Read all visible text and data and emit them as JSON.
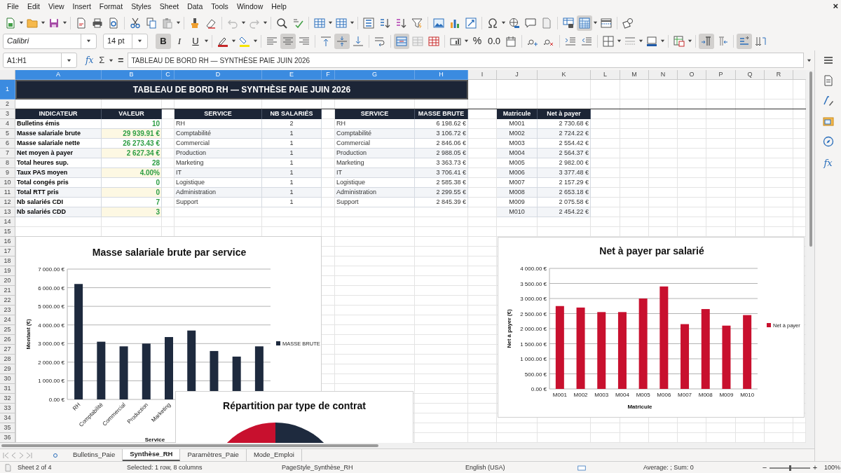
{
  "menu": [
    "File",
    "Edit",
    "View",
    "Insert",
    "Format",
    "Styles",
    "Sheet",
    "Data",
    "Tools",
    "Window",
    "Help"
  ],
  "close_label": "×",
  "standard_toolbar": {
    "freeze_rows_columns": {
      "selected": true
    }
  },
  "formatting_toolbar": {
    "font_name": "Calibri",
    "font_size": "14 pt",
    "bold": {
      "label": "B",
      "selected": true
    },
    "italic": {
      "label": "I",
      "selected": false
    },
    "underline": {
      "label": "U",
      "selected": false
    },
    "align_left": {
      "selected": false
    },
    "align_center": {
      "selected": true
    },
    "align_right": {
      "selected": false
    },
    "align_top": {
      "selected": false
    },
    "align_middle": {
      "selected": true
    },
    "align_bottom": {
      "selected": false
    },
    "merge_and_center": {
      "selected": true
    },
    "percent": {
      "label": "%"
    },
    "decimal": {
      "label": "0.0"
    },
    "left_to_right": {
      "selected": true
    },
    "right_to_left": {
      "selected": false
    },
    "wrap_text": {
      "selected": true
    }
  },
  "formula_bar": {
    "name_box": "A1:H1",
    "function_label": "fx",
    "sum_label": "Σ",
    "equals_label": "=",
    "content": "TABLEAU DE BORD RH — SYNTHÈSE PAIE JUIN 2026"
  },
  "sidebar": {
    "functions_label": "fx"
  },
  "sheet": {
    "columns": [
      {
        "label": "A",
        "selected": true
      },
      {
        "label": "B",
        "selected": true
      },
      {
        "label": "C",
        "selected": true
      },
      {
        "label": "D",
        "selected": true
      },
      {
        "label": "E",
        "selected": true
      },
      {
        "label": "F",
        "selected": true
      },
      {
        "label": "G",
        "selected": true
      },
      {
        "label": "H",
        "selected": true
      },
      {
        "label": "I",
        "selected": false
      },
      {
        "label": "J",
        "selected": false
      },
      {
        "label": "K",
        "selected": false
      },
      {
        "label": "L",
        "selected": false
      },
      {
        "label": "M",
        "selected": false
      },
      {
        "label": "N",
        "selected": false
      },
      {
        "label": "O",
        "selected": false
      },
      {
        "label": "P",
        "selected": false
      },
      {
        "label": "Q",
        "selected": false
      },
      {
        "label": "R",
        "selected": false
      }
    ],
    "rows": [
      {
        "label": "1",
        "selected": true
      },
      {
        "label": "2",
        "selected": false
      },
      {
        "label": "3",
        "selected": false
      },
      {
        "label": "4",
        "selected": false
      },
      {
        "label": "5",
        "selected": false
      },
      {
        "label": "6",
        "selected": false
      },
      {
        "label": "7",
        "selected": false
      },
      {
        "label": "8",
        "selected": false
      },
      {
        "label": "9",
        "selected": false
      },
      {
        "label": "10",
        "selected": false
      },
      {
        "label": "11",
        "selected": false
      },
      {
        "label": "12",
        "selected": false
      },
      {
        "label": "13",
        "selected": false
      },
      {
        "label": "14",
        "selected": false
      },
      {
        "label": "15",
        "selected": false
      },
      {
        "label": "16",
        "selected": false
      },
      {
        "label": "17",
        "selected": false
      },
      {
        "label": "18",
        "selected": false
      },
      {
        "label": "19",
        "selected": false
      },
      {
        "label": "20",
        "selected": false
      },
      {
        "label": "21",
        "selected": false
      },
      {
        "label": "22",
        "selected": false
      },
      {
        "label": "23",
        "selected": false
      },
      {
        "label": "24",
        "selected": false
      },
      {
        "label": "25",
        "selected": false
      },
      {
        "label": "26",
        "selected": false
      },
      {
        "label": "27",
        "selected": false
      },
      {
        "label": "28",
        "selected": false
      },
      {
        "label": "29",
        "selected": false
      },
      {
        "label": "30",
        "selected": false
      },
      {
        "label": "31",
        "selected": false
      },
      {
        "label": "32",
        "selected": false
      },
      {
        "label": "33",
        "selected": false
      },
      {
        "label": "34",
        "selected": false
      },
      {
        "label": "35",
        "selected": false
      },
      {
        "label": "36",
        "selected": false
      }
    ],
    "title": "TABLEAU DE BORD RH — SYNTHÈSE PAIE JUIN 2026",
    "tables": [
      {
        "columns": [
          "INDICATEUR",
          "VALEUR"
        ],
        "rows": [
          [
            "Bulletins émis",
            "10"
          ],
          [
            "Masse salariale brute",
            "29 939.91 €"
          ],
          [
            "Masse salariale nette",
            "26 273.43 €"
          ],
          [
            "Net moyen à payer",
            "2 627.34 €"
          ],
          [
            "Total heures sup.",
            "28"
          ],
          [
            "Taux PAS moyen",
            "4.00%"
          ],
          [
            "Total congés pris",
            "0"
          ],
          [
            "Total RTT pris",
            "0"
          ],
          [
            "Nb salariés CDI",
            "7"
          ],
          [
            "Nb salariés CDD",
            "3"
          ]
        ]
      },
      {
        "columns": [
          "SERVICE",
          "NB SALARIÉS"
        ],
        "rows": [
          [
            "RH",
            "2"
          ],
          [
            "Comptabilité",
            "1"
          ],
          [
            "Commercial",
            "1"
          ],
          [
            "Production",
            "1"
          ],
          [
            "Marketing",
            "1"
          ],
          [
            "IT",
            "1"
          ],
          [
            "Logistique",
            "1"
          ],
          [
            "Administration",
            "1"
          ],
          [
            "Support",
            "1"
          ]
        ]
      },
      {
        "columns": [
          "SERVICE",
          "MASSE BRUTE"
        ],
        "rows": [
          [
            "RH",
            "6 198.62 €"
          ],
          [
            "Comptabilité",
            "3 106.72 €"
          ],
          [
            "Commercial",
            "2 846.06 €"
          ],
          [
            "Production",
            "2 988.05 €"
          ],
          [
            "Marketing",
            "3 363.73 €"
          ],
          [
            "IT",
            "3 706.41 €"
          ],
          [
            "Logistique",
            "2 585.38 €"
          ],
          [
            "Administration",
            "2 299.55 €"
          ],
          [
            "Support",
            "2 845.39 €"
          ]
        ]
      },
      {
        "columns": [
          "Matricule",
          "Net à payer"
        ],
        "rows": [
          [
            "M001",
            "2 730.68 €"
          ],
          [
            "M002",
            "2 724.22 €"
          ],
          [
            "M003",
            "2 554.42 €"
          ],
          [
            "M004",
            "2 564.37 €"
          ],
          [
            "M005",
            "2 982.00 €"
          ],
          [
            "M006",
            "3 377.48 €"
          ],
          [
            "M007",
            "2 157.29 €"
          ],
          [
            "M008",
            "2 653.18 €"
          ],
          [
            "M009",
            "2 075.58 €"
          ],
          [
            "M010",
            "2 454.22 €"
          ]
        ]
      }
    ]
  },
  "charts": [
    {
      "kind": "bar",
      "chart_data": {
        "type": "bar",
        "title": "Masse salariale brute par service",
        "xlabel": "Service",
        "ylabel": "Montant (€)",
        "categories": [
          "RH",
          "Comptabilité",
          "Commercial",
          "Production",
          "Marketing",
          null,
          null,
          null,
          null
        ],
        "grid": true,
        "series": [
          {
            "name": "MASSE BRUTE",
            "color": "#1e2a3e",
            "values": [
              6200,
              3100,
              2850,
              3000,
              3350,
              3700,
              2600,
              2300,
              2850
            ]
          }
        ],
        "ylim": [
          0,
          7000
        ],
        "yticks": [
          {
            "value": 0,
            "label": "0.00 €"
          },
          {
            "value": 1000,
            "label": "1 000.00 €"
          },
          {
            "value": 2000,
            "label": "2 000.00 €"
          },
          {
            "value": 3000,
            "label": "3 000.00 €"
          },
          {
            "value": 4000,
            "label": "4 000.00 €"
          },
          {
            "value": 5000,
            "label": "5 000.00 €"
          },
          {
            "value": 6000,
            "label": "6 000.00 €"
          },
          {
            "value": 7000,
            "label": "7 000.00 €"
          }
        ]
      }
    },
    {
      "kind": "pie",
      "title": "Répartition par type de contrat"
    },
    {
      "kind": "bar",
      "chart_data": {
        "type": "bar",
        "title": "Net à payer par salarié",
        "xlabel": "Matricule",
        "ylabel": "Net à payer (€)",
        "grid": true,
        "categories": [
          "M001",
          "M002",
          "M003",
          "M004",
          "M005",
          "M006",
          "M007",
          "M008",
          "M009",
          "M010"
        ],
        "series": [
          {
            "name": "Net à payer",
            "color": "#c8102e",
            "values": [
              2750,
              2700,
              2550,
              2550,
              3000,
              3400,
              2150,
              2650,
              2100,
              2450
            ]
          }
        ],
        "ylim": [
          0,
          4000
        ],
        "yticks": [
          {
            "value": 0,
            "label": "0.00 €"
          },
          {
            "value": 500,
            "label": "500.00 €"
          },
          {
            "value": 1000,
            "label": "1 000.00 €"
          },
          {
            "value": 1500,
            "label": "1 500.00 €"
          },
          {
            "value": 2000,
            "label": "2 000.00 €"
          },
          {
            "value": 2500,
            "label": "2 500.00 €"
          },
          {
            "value": 3000,
            "label": "3 000.00 €"
          },
          {
            "value": 3500,
            "label": "3 500.00 €"
          },
          {
            "value": 4000,
            "label": "4 000.00 €"
          }
        ]
      }
    }
  ],
  "sheet_tabs": [
    {
      "label": "Bulletins_Paie",
      "selected": false
    },
    {
      "label": "Synthèse_RH",
      "selected": true
    },
    {
      "label": "Paramètres_Paie",
      "selected": false
    },
    {
      "label": "Mode_Emploi",
      "selected": false
    }
  ],
  "status_bar": {
    "sheet": "Sheet 2 of 4",
    "selection": "Selected: 1 row, 8 columns",
    "page_style": "PageStyle_Synthèse_RH",
    "language": "English (USA)",
    "summary": "Average: ; Sum: 0",
    "zoom_out": "−",
    "zoom_in": "+",
    "zoom": "100%",
    "zoom_slider": {
      "level": 0.5
    }
  }
}
